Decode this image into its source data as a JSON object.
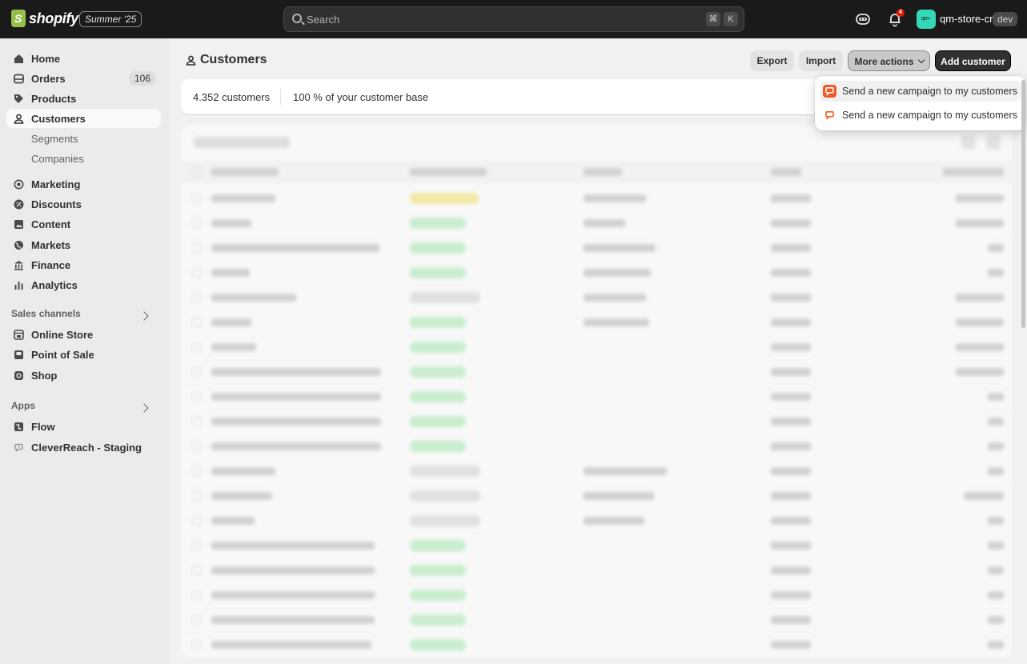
{
  "topbar": {
    "logo_text": "shopify",
    "edition": "Summer '25",
    "search_placeholder": "Search",
    "shortcut_mod": "⌘",
    "shortcut_key": "K",
    "notification_count": "4",
    "store_avatar_text": "qm-",
    "store_name": "qm-store-cr",
    "env_badge": "dev"
  },
  "sidebar": {
    "main": [
      {
        "label": "Home",
        "icon": "home-icon"
      },
      {
        "label": "Orders",
        "icon": "orders-icon",
        "count": "106"
      },
      {
        "label": "Products",
        "icon": "tag-icon"
      },
      {
        "label": "Customers",
        "icon": "person-icon",
        "active": true
      },
      {
        "label": "Segments",
        "sub": true
      },
      {
        "label": "Companies",
        "sub": true
      },
      {
        "label": "Marketing",
        "icon": "target-icon"
      },
      {
        "label": "Discounts",
        "icon": "discount-icon"
      },
      {
        "label": "Content",
        "icon": "content-icon"
      },
      {
        "label": "Markets",
        "icon": "globe-icon"
      },
      {
        "label": "Finance",
        "icon": "bank-icon"
      },
      {
        "label": "Analytics",
        "icon": "chart-icon"
      }
    ],
    "sales_channels_title": "Sales channels",
    "sales_channels": [
      {
        "label": "Online Store",
        "icon": "store-icon"
      },
      {
        "label": "Point of Sale",
        "icon": "pos-icon"
      },
      {
        "label": "Shop",
        "icon": "shop-icon"
      }
    ],
    "apps_title": "Apps",
    "apps": [
      {
        "label": "Flow",
        "icon": "flow-icon"
      },
      {
        "label": "CleverReach - Staging",
        "icon": "cleverreach-icon"
      }
    ]
  },
  "page": {
    "title": "Customers",
    "export_label": "Export",
    "import_label": "Import",
    "more_actions_label": "More actions",
    "add_customer_label": "Add customer"
  },
  "summary": {
    "count": "4.352",
    "count_suffix": "customers",
    "share": "100 %",
    "share_suffix": "of your customer base"
  },
  "dropdown": {
    "items": [
      {
        "label": "Send a new campaign to my customers"
      },
      {
        "label": "Send a new campaign to my customers"
      }
    ]
  },
  "colors": {
    "topbar": "#1a1a1a",
    "accent_cleverreach": "#f05a28",
    "subscribed_pill": "#a8ecb0",
    "pending_pill": "#f5e36b"
  }
}
